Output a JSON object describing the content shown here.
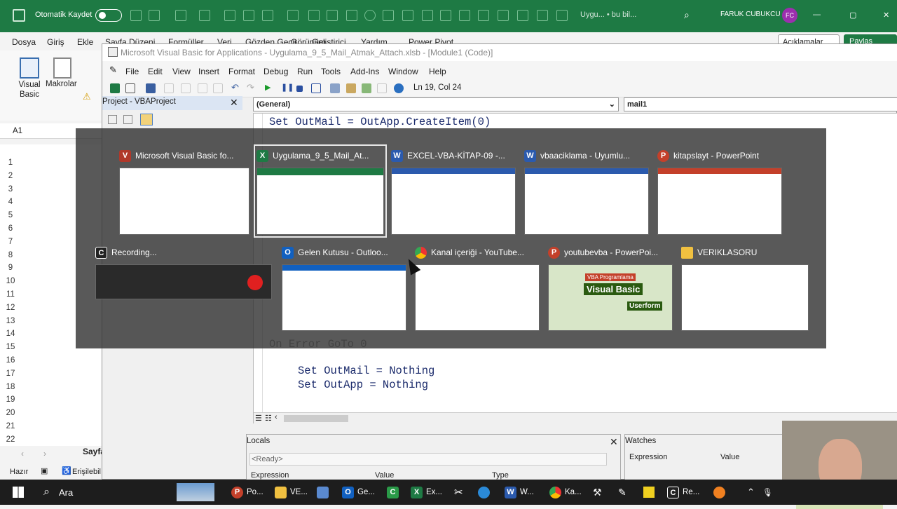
{
  "excel": {
    "autosave_label": "Otomatik Kaydet",
    "doc_title": "Uygu... • bu bil...",
    "user_name": "FARUK CUBUKCU",
    "user_initials": "FC",
    "menu": [
      "Dosya",
      "Giriş",
      "Ekle",
      "Sayfa Düzeni",
      "Formüller",
      "Veri",
      "Gözden Geçir",
      "Görünüm",
      "Geliştirici",
      "Yardım",
      "Power Pivot"
    ],
    "comments_label": "Açıklamalar",
    "share_label": "Paylaş",
    "ribbon": {
      "visual_basic": "Visual Basic",
      "macros": "Makrolar"
    },
    "name_box": "A1",
    "column_header": "A",
    "rows": [
      "1",
      "2",
      "3",
      "4",
      "5",
      "6",
      "7",
      "8",
      "9",
      "10",
      "11",
      "12",
      "13",
      "14",
      "15",
      "16",
      "17",
      "18",
      "19",
      "20",
      "21",
      "22"
    ],
    "sheet_tab": "Sayfa",
    "status_ready": "Hazır",
    "status_access": "Erişilebil"
  },
  "vbe": {
    "title": "Microsoft Visual Basic for Applications - Uygulama_9_5_Mail_Atmak_Attach.xlsb - [Module1 (Code)]",
    "menu": [
      "File",
      "Edit",
      "View",
      "Insert",
      "Format",
      "Debug",
      "Run",
      "Tools",
      "Add-Ins",
      "Window",
      "Help"
    ],
    "cursor_position": "Ln 19, Col 24",
    "project_panel_title": "Project - VBAProject",
    "object_dropdown": "(General)",
    "proc_dropdown": "mail1",
    "code_lines": {
      "top": "Set OutMail = OutApp.CreateItem(0)",
      "on_error": "On Error GoTo 0",
      "set_mail": "Set OutMail = Nothing",
      "set_app": "Set OutApp = Nothing"
    },
    "locals_title": "Locals",
    "locals_status": "<Ready>",
    "locals_columns": [
      "Expression",
      "Value",
      "Type"
    ],
    "watches_title": "Watches",
    "watches_columns": [
      "Expression",
      "Value"
    ]
  },
  "task_view": {
    "windows": [
      {
        "label": "Microsoft Visual Basic fo...",
        "icon": "vba-icon"
      },
      {
        "label": "Uygulama_9_5_Mail_At...",
        "icon": "excel-icon",
        "selected": true
      },
      {
        "label": "EXCEL-VBA-KİTAP-09 -...",
        "icon": "word-icon"
      },
      {
        "label": "vbaaciklama  -  Uyumlu...",
        "icon": "word-icon"
      },
      {
        "label": "kitapslayt - PowerPoint",
        "icon": "powerpoint-icon"
      },
      {
        "label": "Recording...",
        "icon": "recorder-icon"
      },
      {
        "label": "Gelen Kutusu - Outloo...",
        "icon": "outlook-icon"
      },
      {
        "label": "Kanal içeriği - YouTube...",
        "icon": "chrome-icon"
      },
      {
        "label": "youtubevba - PowerPoi...",
        "icon": "powerpoint-icon"
      },
      {
        "label": "VERIKLASORU",
        "icon": "folder-icon"
      }
    ],
    "thumb_text": {
      "vba_course": "VBA Programlama",
      "visual_basic": "Visual Basic",
      "userform": "Userform"
    }
  },
  "taskbar": {
    "search_label": "Ara",
    "items": [
      "Po...",
      "VE...",
      "Ge...",
      "Ex...",
      "W...",
      "Ka...",
      "Re..."
    ]
  },
  "colors": {
    "excel_green": "#1e7a44",
    "accent_purple": "#9b2fae"
  }
}
